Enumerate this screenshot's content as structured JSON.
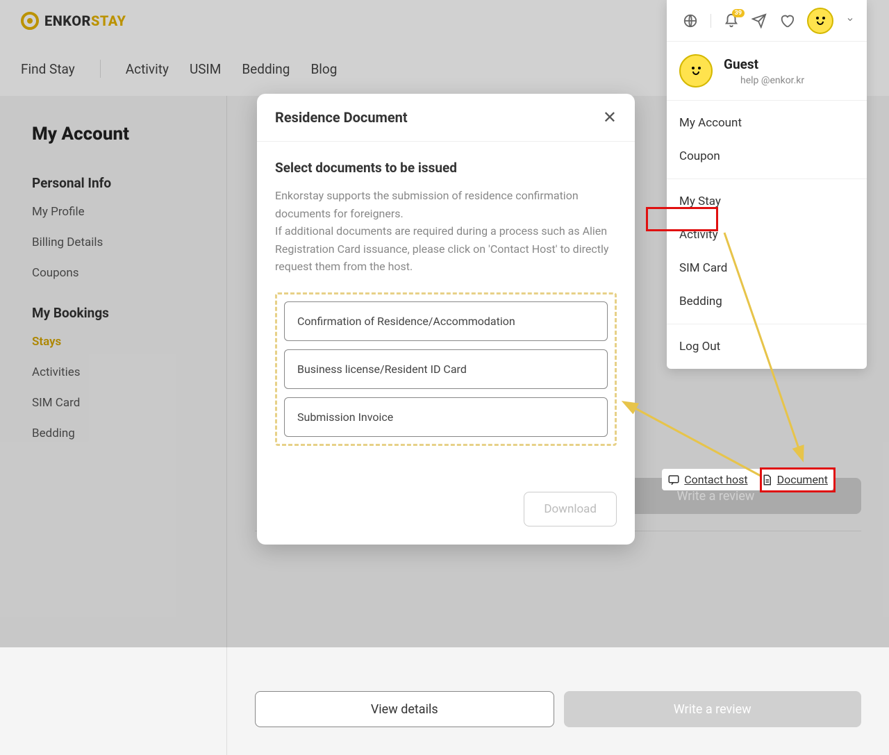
{
  "logo": {
    "pre": "ENKOR",
    "post": "STAY"
  },
  "nav": [
    "Find Stay",
    "Activity",
    "USIM",
    "Bedding",
    "Blog"
  ],
  "notif_count": "39",
  "sidebar": {
    "page_title": "My Account",
    "section1": "Personal Info",
    "links1": [
      "My Profile",
      "Billing Details",
      "Coupons"
    ],
    "section2": "My Bookings",
    "links2": [
      "Stays",
      "Activities",
      "SIM Card",
      "Bedding"
    ]
  },
  "dropdown": {
    "name": "Guest",
    "email": "help @enkor.kr",
    "group1": [
      "My Account",
      "Coupon"
    ],
    "group2": [
      "My Stay",
      "Activity",
      "SIM Card",
      "Bedding"
    ],
    "group3": [
      "Log Out"
    ]
  },
  "modal": {
    "title": "Residence Document",
    "subtitle": "Select documents to be issued",
    "desc": "Enkorstay supports the submission of residence confirmation documents for foreigners.\nIf additional documents are required during a process such as Alien Registration Card issuance, please click on 'Contact Host' to directly request them from the host.",
    "options": [
      "Confirmation of Residence/Accommodation",
      "Business license/Resident ID Card",
      "Submission Invoice"
    ],
    "download": "Download"
  },
  "actions": {
    "contact_host": "Contact host",
    "document": "Document",
    "view_details": "View details",
    "write_review": "Write a review"
  }
}
